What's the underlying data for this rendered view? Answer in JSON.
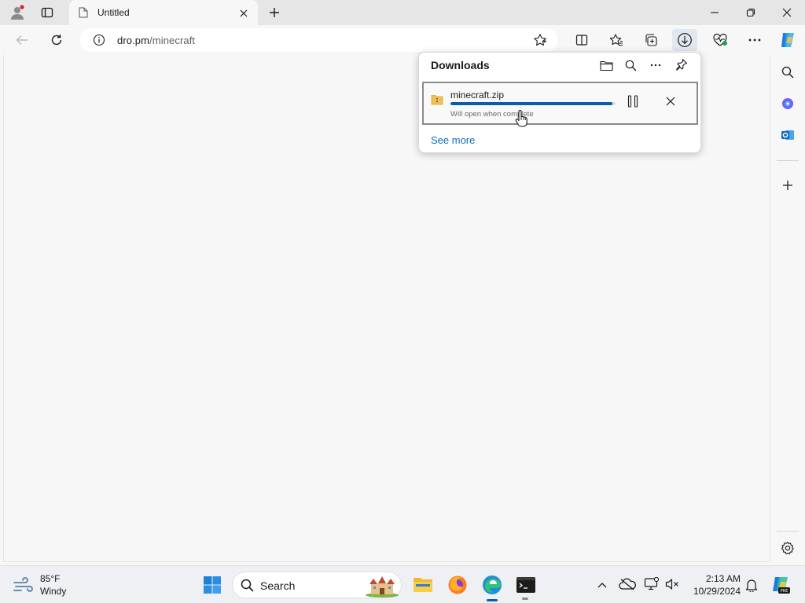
{
  "browser": {
    "tab_title": "Untitled",
    "url_host": "dro.pm",
    "url_path": "/minecraft"
  },
  "downloads": {
    "title": "Downloads",
    "item": {
      "file_name": "minecraft.zip",
      "status": "Will open when complete",
      "progress": 0.98
    },
    "see_more": "See more"
  },
  "taskbar": {
    "weather_temp": "85°F",
    "weather_condition": "Windy",
    "search_label": "Search",
    "time": "2:13 AM",
    "date": "10/29/2024"
  },
  "colors": {
    "accent": "#0b5cad",
    "link": "#0f6cbd",
    "copilot": "#1f7ae0"
  },
  "icons": {
    "titlebar": [
      "profile-icon",
      "tab-actions-icon",
      "page-icon",
      "close-tab-icon",
      "new-tab-icon",
      "minimize-icon",
      "restore-icon",
      "close-window-icon"
    ],
    "toolbar": [
      "back-icon",
      "refresh-icon",
      "info-icon",
      "favorite-star-icon",
      "split-screen-icon",
      "favorites-icon",
      "collections-icon",
      "download-icon",
      "browser-essentials-icon",
      "more-icon",
      "copilot-icon"
    ],
    "sidebar": [
      "search-icon",
      "copilot-sidebar-icon",
      "outlook-icon",
      "add-icon",
      "settings-icon"
    ],
    "downloads": [
      "open-folder-icon",
      "search-downloads-icon",
      "more-options-icon",
      "pin-icon",
      "zip-file-icon",
      "pause-icon",
      "cancel-icon"
    ],
    "taskbar": [
      "weather-wind-icon",
      "start-icon",
      "search-icon",
      "castle-widget-icon",
      "file-explorer-icon",
      "firefox-icon",
      "edge-icon",
      "terminal-icon",
      "chevron-up-icon",
      "onedrive-icon",
      "network-icon",
      "volume-muted-icon",
      "notifications-icon",
      "copilot-pre-icon"
    ]
  }
}
